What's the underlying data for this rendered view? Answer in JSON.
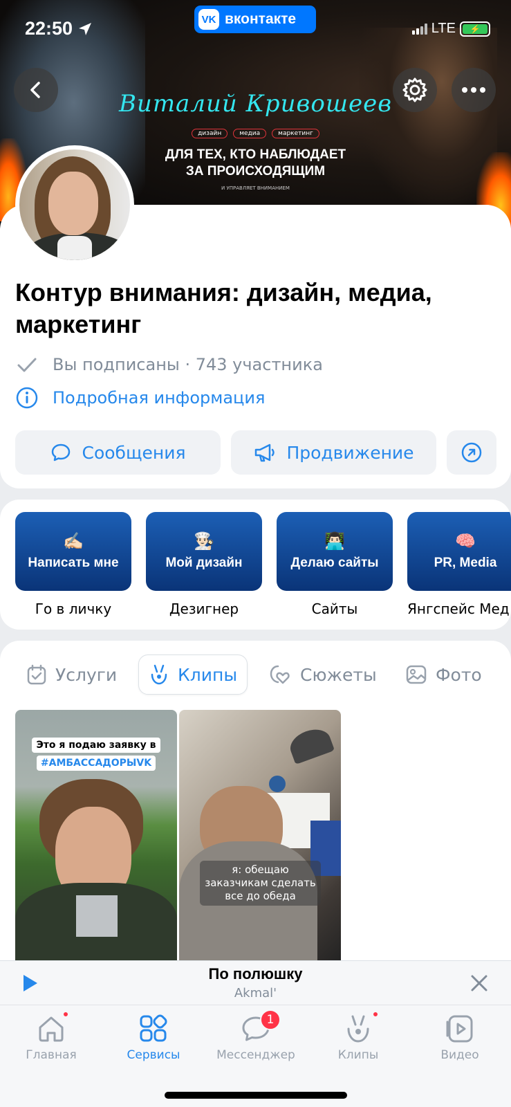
{
  "status_bar": {
    "time": "22:50",
    "network": "LTE"
  },
  "top_badge": {
    "label": "вконтакте",
    "logo": "vk"
  },
  "cover": {
    "name": "Виталий Кривошеев",
    "tags": [
      "дизайн",
      "медиа",
      "маркетинг"
    ],
    "slogan_line1": "ДЛЯ ТЕХ, КТО НАБЛЮДАЕТ",
    "slogan_line2": "ЗА ПРОИСХОДЯЩИМ",
    "small_text": "И УПРАВЛЯЕТ ВНИМАНИЕМ"
  },
  "group": {
    "title": "Контур внимания: дизайн, медиа, маркетинг",
    "subscription_status": "Вы подписаны · 743 участника",
    "more_info": "Подробная информация"
  },
  "actions": {
    "messages": "Сообщения",
    "promotion": "Продвижение"
  },
  "menu": [
    {
      "emoji": "✍🏻",
      "label": "Написать мне",
      "caption": "Го в личку"
    },
    {
      "emoji": "👨🏻‍🍳",
      "label": "Мой дизайн",
      "caption": "Дезигнер"
    },
    {
      "emoji": "👨🏻‍💻",
      "label": "Делаю сайты",
      "caption": "Сайты"
    },
    {
      "emoji": "🧠",
      "label": "PR, Media",
      "caption": "Янгспейс Мед"
    }
  ],
  "content_tabs": [
    {
      "label": "Услуги",
      "icon": "calendar-check-icon",
      "active": false
    },
    {
      "label": "Клипы",
      "icon": "clips-icon",
      "active": true
    },
    {
      "label": "Сюжеты",
      "icon": "stories-heart-icon",
      "active": false
    },
    {
      "label": "Фото",
      "icon": "photo-icon",
      "active": false
    }
  ],
  "clips": [
    {
      "caption_line1": "Это я подаю заявку в",
      "caption_line2": "#АМБАССАДОРЫVK"
    },
    {
      "caption": "я: обещаю заказчикам сделать все до обеда"
    }
  ],
  "player": {
    "title": "По полюшку",
    "artist": "Akmal'"
  },
  "tabbar": [
    {
      "label": "Главная",
      "icon": "home-icon",
      "active": false,
      "dot": true
    },
    {
      "label": "Сервисы",
      "icon": "services-grid-icon",
      "active": true
    },
    {
      "label": "Мессенджер",
      "icon": "messenger-icon",
      "active": false,
      "badge": "1"
    },
    {
      "label": "Клипы",
      "icon": "clips-icon",
      "active": false,
      "dot": true
    },
    {
      "label": "Видео",
      "icon": "video-icon",
      "active": false
    }
  ],
  "colors": {
    "accent": "#2688eb",
    "brand": "#0077ff",
    "tile_blue": "#0a3478",
    "badge_red": "#ff3347"
  }
}
